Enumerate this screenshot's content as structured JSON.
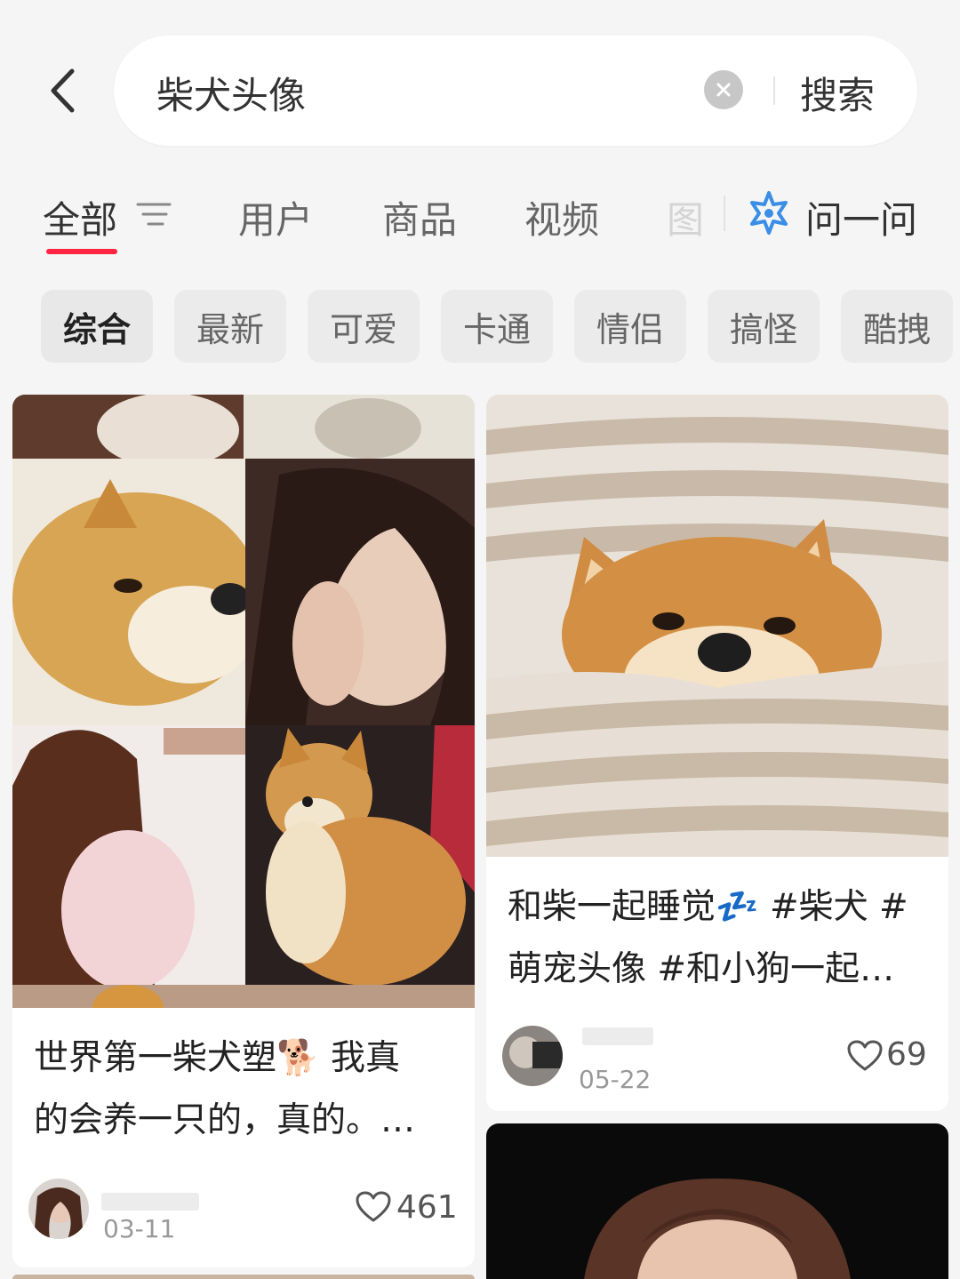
{
  "search": {
    "query": "柴犬头像",
    "button_label": "搜索"
  },
  "tabs": [
    {
      "label": "全部"
    },
    {
      "label": "用户"
    },
    {
      "label": "商品"
    },
    {
      "label": "视频"
    },
    {
      "label": "图"
    },
    {
      "label": "问一问"
    }
  ],
  "chips": [
    {
      "label": "综合"
    },
    {
      "label": "最新"
    },
    {
      "label": "可爱"
    },
    {
      "label": "卡通"
    },
    {
      "label": "情侣"
    },
    {
      "label": "搞怪"
    },
    {
      "label": "酷拽"
    }
  ],
  "colors": {
    "accent": "#ff2442",
    "ask_icon": "#3a8ee6"
  },
  "posts": [
    {
      "title_line1": "世界第一柴犬塑🐕 我真",
      "title_line2": "的会养一只的，真的。…",
      "date": "03-11",
      "likes": "461"
    },
    {
      "title_line1": "和柴一起睡觉💤 #柴犬 #",
      "title_line2": "萌宠头像 #和小狗一起…",
      "date": "05-22",
      "likes": "69"
    }
  ]
}
